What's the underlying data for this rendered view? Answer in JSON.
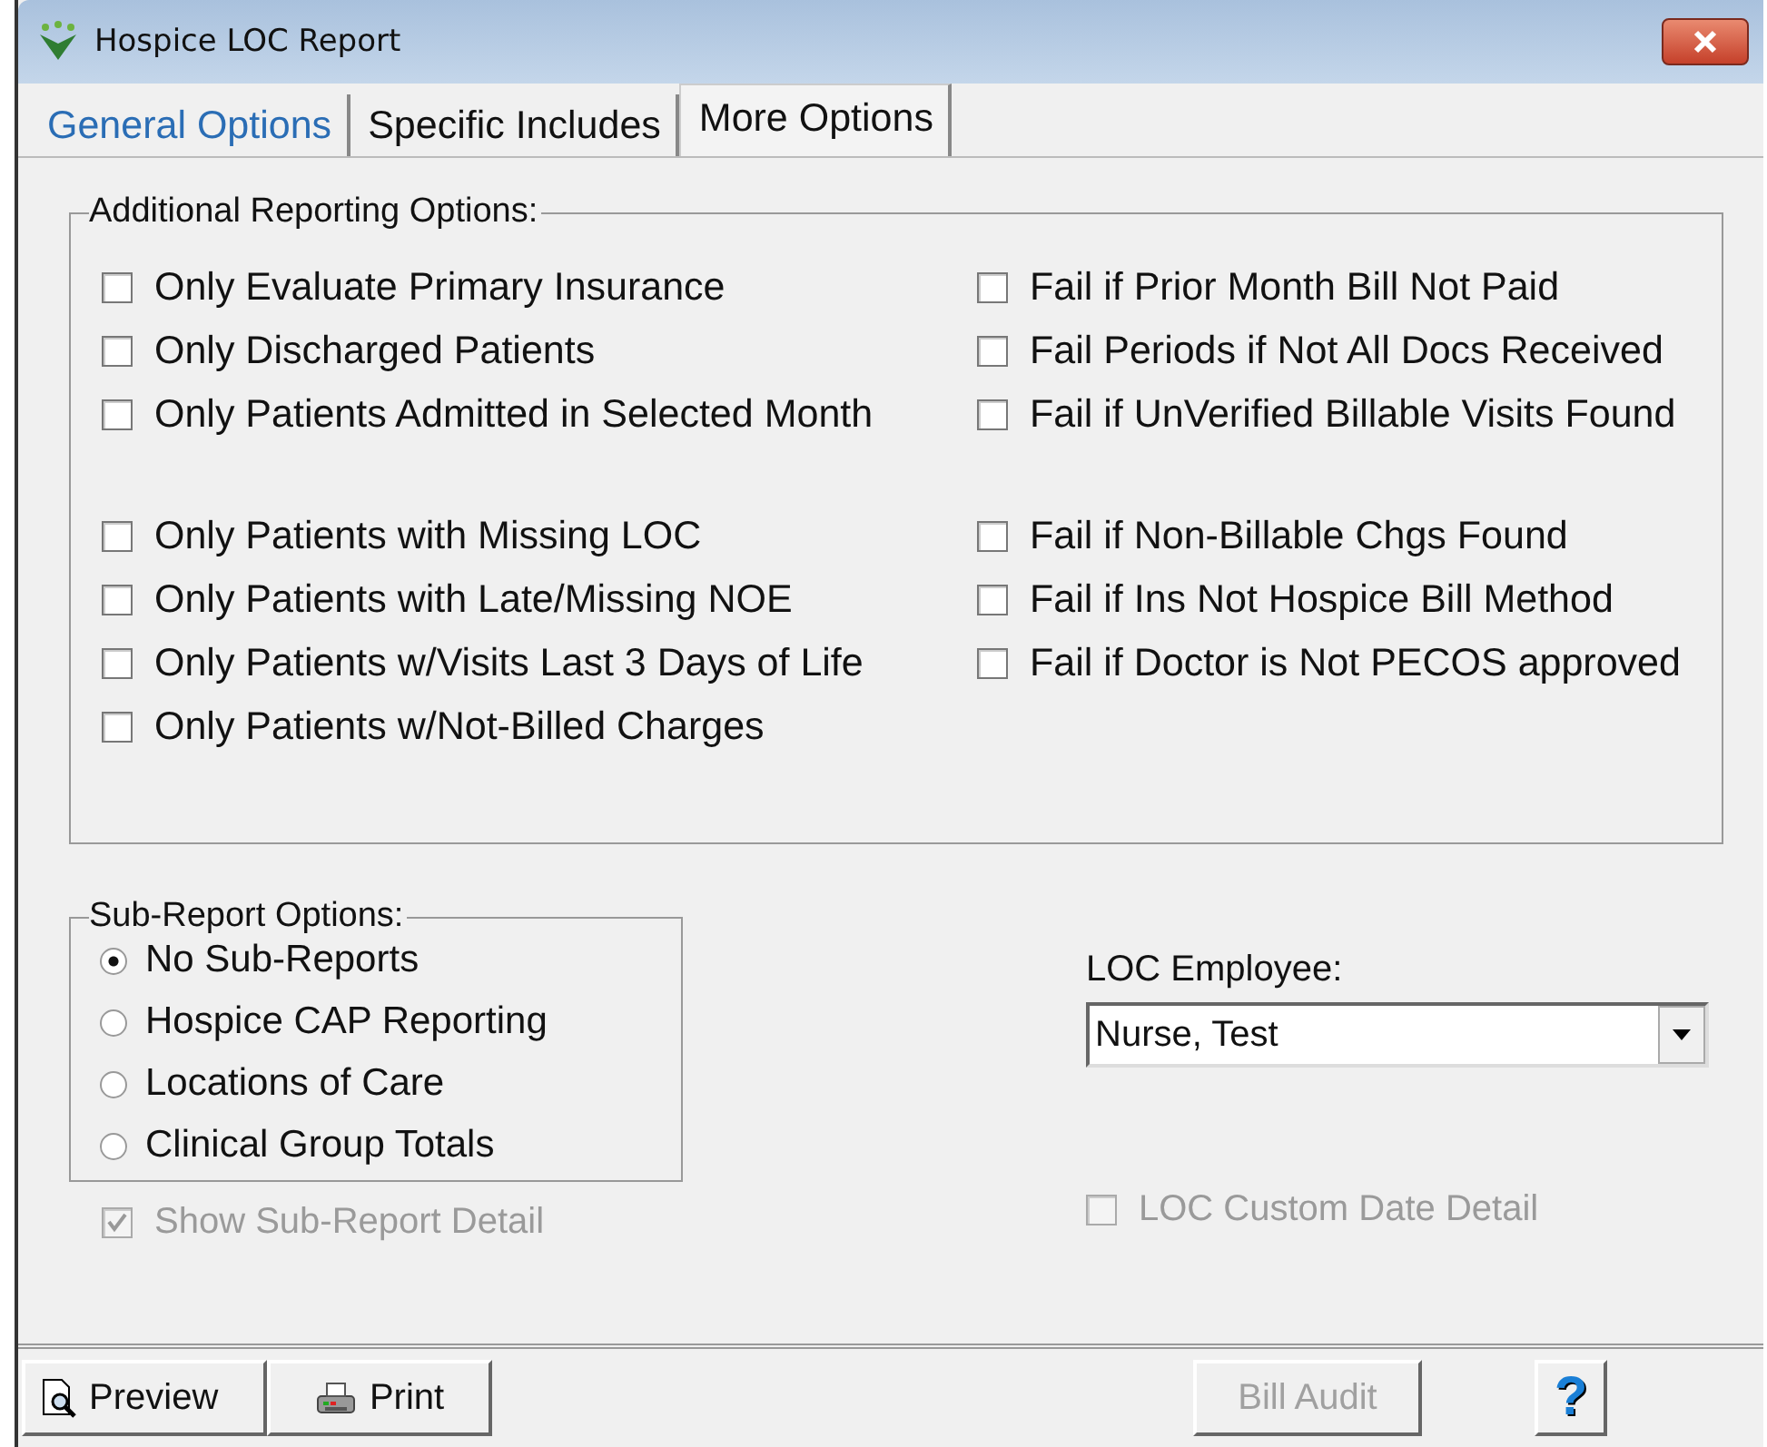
{
  "window": {
    "title": "Hospice LOC Report"
  },
  "tabs": [
    {
      "label": "General Options",
      "selected": false,
      "kind": "link"
    },
    {
      "label": "Specific Includes",
      "selected": false,
      "kind": "plain"
    },
    {
      "label": "More Options",
      "selected": true,
      "kind": "plain"
    }
  ],
  "reporting_options": {
    "title": "Additional Reporting Options:",
    "columns": [
      {
        "groups": [
          [
            {
              "label": "Only Evaluate Primary Insurance",
              "checked": false
            },
            {
              "label": "Only Discharged Patients",
              "checked": false
            },
            {
              "label": "Only Patients Admitted in Selected Month",
              "checked": false
            }
          ],
          [
            {
              "label": "Only Patients with Missing LOC",
              "checked": false
            },
            {
              "label": "Only Patients with Late/Missing NOE",
              "checked": false
            },
            {
              "label": "Only Patients w/Visits Last 3 Days of Life",
              "checked": false
            },
            {
              "label": "Only Patients w/Not-Billed Charges",
              "checked": false
            }
          ]
        ]
      },
      {
        "groups": [
          [
            {
              "label": "Fail if Prior Month Bill Not Paid",
              "checked": false
            },
            {
              "label": "Fail Periods if Not All Docs Received",
              "checked": false
            },
            {
              "label": "Fail if UnVerified Billable Visits Found",
              "checked": false
            }
          ],
          [
            {
              "label": "Fail if Non-Billable Chgs Found",
              "checked": false
            },
            {
              "label": "Fail if Ins Not Hospice Bill Method",
              "checked": false
            },
            {
              "label": "Fail if Doctor is Not PECOS approved",
              "checked": false
            }
          ]
        ]
      }
    ]
  },
  "sub_report_options": {
    "title": "Sub-Report Options:",
    "options": [
      {
        "label": "No Sub-Reports",
        "selected": true
      },
      {
        "label": "Hospice CAP Reporting",
        "selected": false
      },
      {
        "label": "Locations of Care",
        "selected": false
      },
      {
        "label": "Clinical Group Totals",
        "selected": false
      }
    ]
  },
  "show_sub_report_detail": {
    "label": "Show Sub-Report Detail",
    "checked": true,
    "disabled": true
  },
  "loc_employee": {
    "label": "LOC Employee:",
    "value": "Nurse, Test"
  },
  "loc_custom_date_detail": {
    "label": "LOC Custom Date Detail",
    "checked": false,
    "disabled": true
  },
  "buttons": [
    {
      "label": "Preview",
      "kind": "preview",
      "disabled": false
    },
    {
      "label": "Print",
      "kind": "print",
      "disabled": false
    },
    {
      "label": "Bill Audit",
      "kind": "text",
      "disabled": true
    },
    {
      "label": "?",
      "kind": "help",
      "disabled": false
    }
  ]
}
